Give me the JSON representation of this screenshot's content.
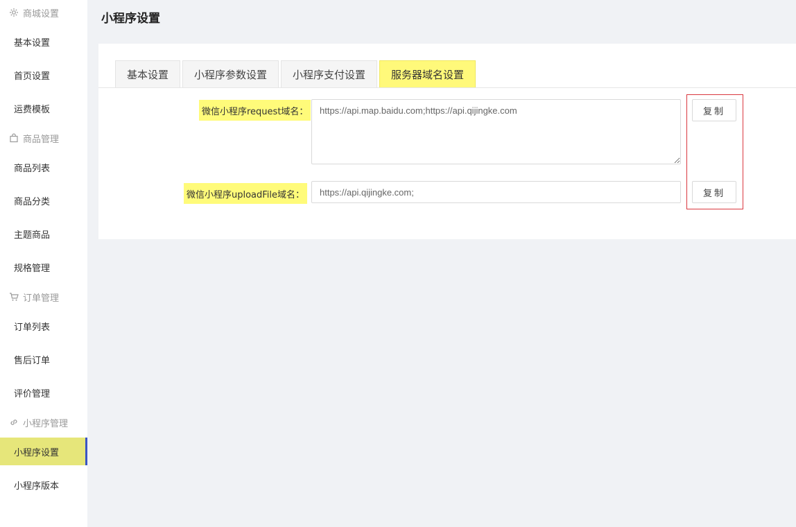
{
  "sidebar": {
    "groups": [
      {
        "title": "商城设置",
        "icon": "gear-icon"
      },
      {
        "title": "商品管理",
        "icon": "shopping-bag-icon"
      },
      {
        "title": "订单管理",
        "icon": "cart-icon"
      },
      {
        "title": "小程序管理",
        "icon": "link-icon"
      }
    ],
    "items": [
      {
        "label": "基本设置"
      },
      {
        "label": "首页设置"
      },
      {
        "label": "运费模板"
      },
      {
        "label": "商品列表"
      },
      {
        "label": "商品分类"
      },
      {
        "label": "主题商品"
      },
      {
        "label": "规格管理"
      },
      {
        "label": "订单列表"
      },
      {
        "label": "售后订单"
      },
      {
        "label": "评价管理"
      },
      {
        "label": "小程序设置",
        "active": true
      },
      {
        "label": "小程序版本"
      }
    ]
  },
  "header": {
    "title": "小程序设置"
  },
  "tabs": [
    {
      "label": "基本设置"
    },
    {
      "label": "小程序参数设置"
    },
    {
      "label": "小程序支付设置"
    },
    {
      "label": "服务器域名设置",
      "active": true
    }
  ],
  "form": {
    "request_label": "微信小程序request域名：",
    "request_value": "https://api.map.baidu.com;https://api.qijingke.com",
    "upload_label": "微信小程序uploadFile域名：",
    "upload_value": "https://api.qijingke.com;",
    "copy_label": "复制"
  },
  "colors": {
    "highlight": "#fffb7a",
    "active_nav": "#e6e67a",
    "active_border": "#3a55c4",
    "copy_box_border": "#d9363e"
  }
}
